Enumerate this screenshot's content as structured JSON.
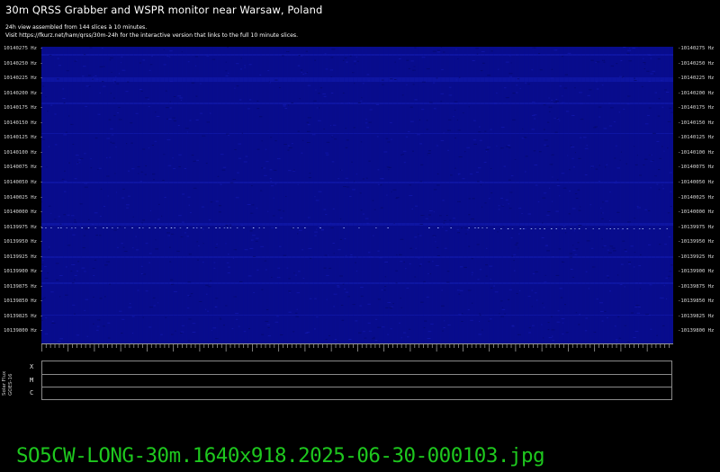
{
  "header": {
    "title": "30m QRSS Grabber and WSPR monitor near Warsaw, Poland",
    "subtitle_line1": "24h view assembled from 144 slices à 10 minutes.",
    "subtitle_line2": "Visit https://fkurz.net/ham/qrss/30m-24h for the interactive version that links to the full 10 minute slices."
  },
  "spectrogram": {
    "frequency_labels": [
      "10140275 Hz",
      "10140250 Hz",
      "10140225 Hz",
      "10140200 Hz",
      "10140175 Hz",
      "10140150 Hz",
      "10140125 Hz",
      "10140100 Hz",
      "10140075 Hz",
      "10140050 Hz",
      "10140025 Hz",
      "10140000 Hz",
      "10139975 Hz",
      "10139950 Hz",
      "10139925 Hz",
      "10139900 Hz",
      "10139875 Hz",
      "10139850 Hz",
      "10139825 Hz",
      "10139800 Hz"
    ],
    "colors": {
      "background": "#080c8c",
      "band": "#1016a4",
      "signal": "#b4c8ff"
    }
  },
  "solar_flux": {
    "label_line1": "Solar Flux",
    "label_line2": "GOES-16",
    "classes": [
      "X",
      "M",
      "C"
    ]
  },
  "footer": {
    "filename": "SO5CW-LONG-30m.1640x918.2025-06-30-000103.jpg",
    "color": "#1ec81e"
  }
}
